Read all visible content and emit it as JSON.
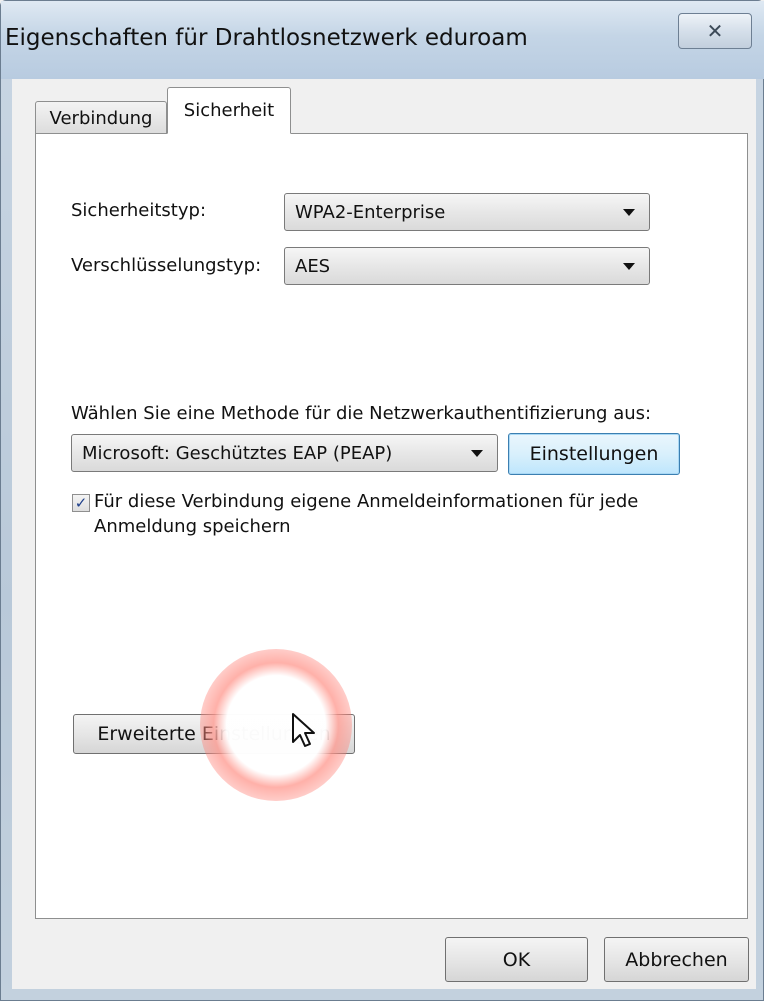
{
  "window": {
    "title": "Eigenschaften für Drahtlosnetzwerk eduroam",
    "close_icon": "close-icon",
    "close_glyph": "✕"
  },
  "tabs": [
    {
      "label": "Verbindung",
      "active": false
    },
    {
      "label": "Sicherheit",
      "active": true
    }
  ],
  "security": {
    "security_type_label": "Sicherheitstyp:",
    "security_type_value": "WPA2-Enterprise",
    "encryption_type_label": "Verschlüsselungstyp:",
    "encryption_type_value": "AES"
  },
  "auth": {
    "method_label": "Wählen Sie eine Methode für die Netzwerkauthentifizierung aus:",
    "method_value": "Microsoft: Geschütztes EAP (PEAP)",
    "settings_button": "Einstellungen",
    "remember_checked": true,
    "remember_text": "Für diese Verbindung eigene Anmeldeinformationen für jede Anmeldung speichern"
  },
  "advanced_button": "Erweiterte Einstellungen",
  "footer": {
    "ok_button": "OK",
    "cancel_button": "Abbrechen"
  },
  "colors": {
    "accent_focus": "#3c7fb1",
    "highlight": "#ff7a6e"
  }
}
